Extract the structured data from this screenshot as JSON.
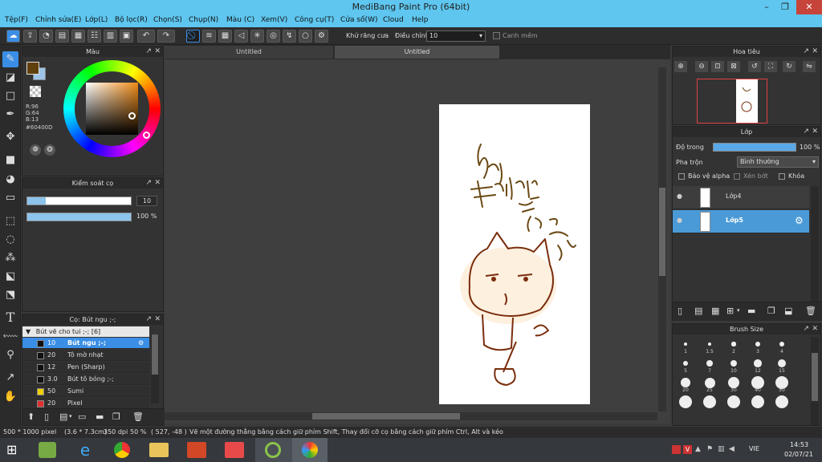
{
  "window": {
    "title": "MediBang Paint Pro (64bit)",
    "minimize_icon": "minimize-icon",
    "maximize_icon": "maximize-icon",
    "close_icon": "close-icon"
  },
  "menu": [
    "Tệp(F)",
    "Chỉnh sửa(E)",
    "Lớp(L)",
    "Bộ lọc(R)",
    "Chọn(S)",
    "Chụp(N)",
    "Màu (C)",
    "Xem(V)",
    "Công cụ(T)",
    "Cửa số(W)",
    "Cloud",
    "Help"
  ],
  "toolbar": {
    "antialias_label": "Khử răng cưa",
    "antialias_checked": true,
    "correction_label": "Điều chỉnh",
    "correction_value": "10",
    "edge_label": "Canh mềm",
    "edge_checked": false
  },
  "tools": [
    "brush-tool",
    "eraser-tool",
    "rectangle-tool",
    "pen-tool",
    "move-tool",
    "fill-rect-tool",
    "bucket-tool",
    "gradient-tool",
    "select-tool",
    "lasso-tool",
    "magic-wand-tool",
    "select-pen-tool",
    "select-eraser-tool",
    "text-tool",
    "operation-tool",
    "dropper-tool",
    "hand-tool"
  ],
  "color_panel": {
    "title": "Màu",
    "r": "R:96",
    "g": "G:64",
    "b": "B:13",
    "hex": "#60400D",
    "primary": "#60400D",
    "secondary": "#9ec4e8"
  },
  "brush_control": {
    "title": "Kiểm soát cọ",
    "size_value": "10",
    "opacity_value": "100 %",
    "size_fraction": 0.18,
    "opacity_fraction": 1.0
  },
  "brush_list": {
    "title": "Cọ: Bút ngu ;-;",
    "group": "Bút vẽ cho tui ;-; [6]",
    "items": [
      {
        "size": "10",
        "name": "Bút ngu ;-;",
        "selected": true,
        "swatch": "#111111"
      },
      {
        "size": "20",
        "name": "Tô mờ nhạt",
        "selected": false,
        "swatch": "#111111"
      },
      {
        "size": "12",
        "name": "Pen (Sharp)",
        "selected": false,
        "swatch": "#111111"
      },
      {
        "size": "3.0",
        "name": "Bút tô bóng ;-;",
        "selected": false,
        "swatch": "#111111"
      },
      {
        "size": "50",
        "name": "Sumi",
        "selected": false,
        "swatch": "#f0d000"
      },
      {
        "size": "20",
        "name": "Pixel",
        "selected": false,
        "swatch": "#e03030"
      }
    ]
  },
  "tabs": [
    "Untitled",
    "Untitled"
  ],
  "navigator": {
    "title": "Hoa tiêu"
  },
  "layers": {
    "title": "Lớp",
    "opacity_label": "Độ trong",
    "opacity_value": "100 %",
    "opacity_fraction": 1.0,
    "blend_label": "Pha trộn",
    "blend_value": "Bình thường",
    "protect_alpha": "Bảo vệ alpha",
    "clip": "Xén bớt",
    "lock": "Khóa",
    "items": [
      {
        "name": "Lớp4",
        "selected": false
      },
      {
        "name": "Lớp5",
        "selected": true
      }
    ]
  },
  "brush_size": {
    "title": "Brush Size",
    "labels": [
      "1",
      "1.5",
      "2",
      "3",
      "4",
      "5",
      "7",
      "10",
      "12",
      "15",
      "20",
      "25",
      "30",
      "40",
      "50",
      "",
      "",
      "",
      "",
      ""
    ]
  },
  "status": {
    "size": "500 * 1000 pixel",
    "cm": "(3.6 * 7.3cm)",
    "dpi": "350 dpi",
    "zoom": "50 %",
    "coords": "( 527, -48 )",
    "hint": "Vẽ một đường thẳng bằng cách giữ phím Shift, Thay đổi cỡ cọ bằng cách giữ phím Ctrl, Alt và kéo"
  },
  "taskbar": {
    "lang": "VIE",
    "time": "14:53",
    "date": "02/07/21"
  }
}
